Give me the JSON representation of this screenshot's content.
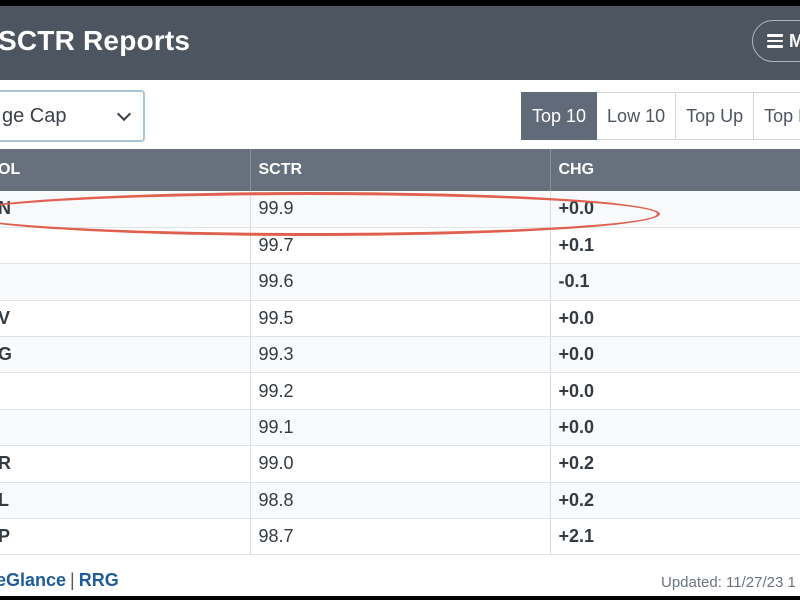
{
  "header": {
    "title": "SCTR Reports",
    "menu_label": "M"
  },
  "toolbar": {
    "universe_select": "ge Cap",
    "tabs": [
      "Top 10",
      "Low 10",
      "Top Up",
      "Top D"
    ],
    "active_tab": "Top 10"
  },
  "table": {
    "columns": [
      "OL",
      "SCTR",
      "CHG"
    ],
    "rows": [
      {
        "symbol": "N",
        "sctr": "99.9",
        "chg": "+0.0",
        "direction": "up"
      },
      {
        "symbol": "",
        "sctr": "99.7",
        "chg": "+0.1",
        "direction": "up"
      },
      {
        "symbol": "",
        "sctr": "99.6",
        "chg": "-0.1",
        "direction": "down"
      },
      {
        "symbol": "V",
        "sctr": "99.5",
        "chg": "+0.0",
        "direction": "up"
      },
      {
        "symbol": "G",
        "sctr": "99.3",
        "chg": "+0.0",
        "direction": "up"
      },
      {
        "symbol": "",
        "sctr": "99.2",
        "chg": "+0.0",
        "direction": "up"
      },
      {
        "symbol": "",
        "sctr": "99.1",
        "chg": "+0.0",
        "direction": "up"
      },
      {
        "symbol": "R",
        "sctr": "99.0",
        "chg": "+0.2",
        "direction": "up"
      },
      {
        "symbol": "L",
        "sctr": "98.8",
        "chg": "+0.2",
        "direction": "up"
      },
      {
        "symbol": "P",
        "sctr": "98.7",
        "chg": "+2.1",
        "direction": "up"
      }
    ]
  },
  "footer": {
    "link_1": "eGlance",
    "separator": "|",
    "link_2": "RRG",
    "updated": "Updated: 11/27/23 1"
  },
  "colors": {
    "header_bg": "#4d5561",
    "active_tab": "#606a78",
    "positive": "#2e8b3c",
    "negative": "#c52a1c",
    "highlight": "#e0604f",
    "link": "#1f5c99"
  }
}
